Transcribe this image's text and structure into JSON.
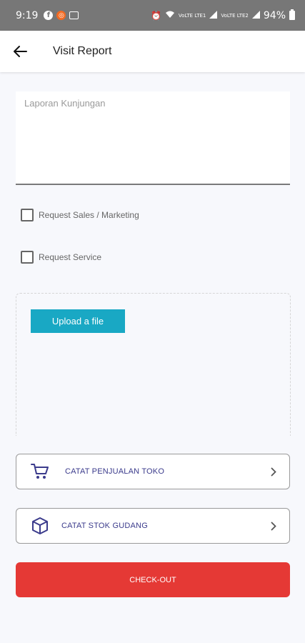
{
  "status_bar": {
    "time": "9:19",
    "battery": "94%",
    "icons": [
      "facebook-icon",
      "orange-app-icon",
      "gallery-icon",
      "alarm-icon",
      "wifi-icon",
      "signal-icon",
      "battery-icon"
    ],
    "lte_1": "VoLTE LTE1",
    "lte_2": "VoLTE LTE2"
  },
  "app_bar": {
    "title": "Visit Report",
    "back_icon": "arrow-left-icon"
  },
  "report": {
    "placeholder": "Laporan Kunjungan",
    "value": ""
  },
  "checkboxes": [
    {
      "label": "Request Sales / Marketing",
      "checked": false
    },
    {
      "label": "Request Service",
      "checked": false
    }
  ],
  "upload": {
    "button_label": "Upload a file"
  },
  "actions": [
    {
      "label": "CATAT PENJUALAN TOKO",
      "icon": "shopping-cart-icon"
    },
    {
      "label": "CATAT STOK GUDANG",
      "icon": "box-icon"
    }
  ],
  "checkout": {
    "label": "CHECK-OUT"
  },
  "colors": {
    "status_bar": "#777777",
    "upload_button": "#19a8c4",
    "checkout_button": "#e53935",
    "action_text": "#3b3b8c"
  }
}
